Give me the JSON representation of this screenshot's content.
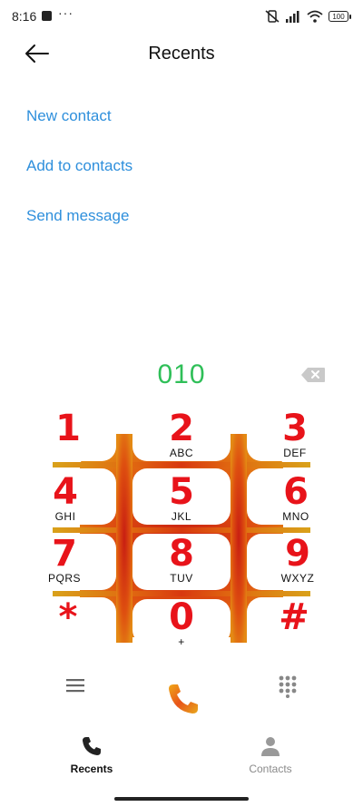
{
  "status_bar": {
    "time": "8:16",
    "more": "···",
    "battery": "100"
  },
  "header": {
    "title": "Recents"
  },
  "actions": [
    "New contact",
    "Add to contacts",
    "Send message"
  ],
  "dialer": {
    "number": "010",
    "keys": [
      {
        "digit": "1",
        "letters": ""
      },
      {
        "digit": "2",
        "letters": "ABC"
      },
      {
        "digit": "3",
        "letters": "DEF"
      },
      {
        "digit": "4",
        "letters": "GHI"
      },
      {
        "digit": "5",
        "letters": "JKL"
      },
      {
        "digit": "6",
        "letters": "MNO"
      },
      {
        "digit": "7",
        "letters": "PQRS"
      },
      {
        "digit": "8",
        "letters": "TUV"
      },
      {
        "digit": "9",
        "letters": "WXYZ"
      },
      {
        "digit": "*",
        "letters": ""
      },
      {
        "digit": "0",
        "letters": "+"
      },
      {
        "digit": "#",
        "letters": ""
      }
    ]
  },
  "colors": {
    "accent": "#2e8fdc",
    "number": "#2fbf58",
    "digit": "#e8131a"
  },
  "bottom_nav": {
    "recents": "Recents",
    "contacts": "Contacts"
  }
}
